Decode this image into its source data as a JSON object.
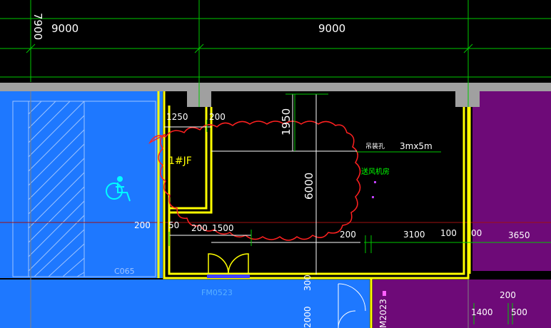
{
  "drawing": {
    "top_axis_dims": [
      "9000",
      "9000"
    ],
    "left_axis_dim": "7900",
    "room_dims": {
      "w1250": "1250",
      "w200a": "200",
      "h1950": "1950",
      "h6000": "6000",
      "d200_left": "200",
      "d50": "50",
      "d200_mid": "200",
      "d1500": "1500",
      "d200_right": "200",
      "d3100": "3100",
      "d100": "100",
      "d00": "00",
      "d3650": "3650",
      "d300": "300",
      "d2000": "2000",
      "d200_bottom": "200",
      "d1400": "1400",
      "d500": "500"
    },
    "labels": {
      "shaft": "1#JF",
      "equipment_tag": "吊装孔",
      "equipment_size": "3mx5m",
      "fan_room": "送风机房",
      "window_code": "C065",
      "door_code_left": "FM0523",
      "door_code_right": "M2023"
    },
    "icons": [
      "wheelchair-accessibility-icon",
      "double-door-symbol"
    ],
    "colors": {
      "background": "#000000",
      "blue_zone": "#1E78FF",
      "purple_zone": "#6E0A78",
      "wall_yellow": "#FFFF00",
      "grid_green": "#00C800",
      "dim_white": "#FFFFFF",
      "revision_cloud": "#FF2020",
      "cyan_symbol": "#00FFFF"
    }
  }
}
